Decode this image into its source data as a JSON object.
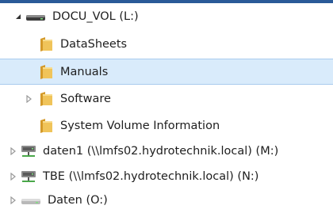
{
  "tree": {
    "drive_docu": {
      "label": "DOCU_VOL (L:)",
      "icon": "drive-icon",
      "expanded": true
    },
    "folders": [
      {
        "label": "DataSheets",
        "icon": "folder-icon",
        "has_children": false,
        "selected": false
      },
      {
        "label": "Manuals",
        "icon": "folder-icon",
        "has_children": false,
        "selected": true
      },
      {
        "label": "Software",
        "icon": "folder-icon",
        "has_children": true,
        "selected": false
      },
      {
        "label": "System Volume Information",
        "icon": "folder-icon",
        "has_children": false,
        "selected": false
      }
    ],
    "network_drives": [
      {
        "label": "daten1 (\\\\lmfs02.hydrotechnik.local) (M:)",
        "icon": "network-drive-icon"
      },
      {
        "label": "TBE (\\\\lmfs02.hydrotechnik.local) (N:)",
        "icon": "network-drive-icon"
      }
    ],
    "drive_daten": {
      "label": "Daten (O:)",
      "icon": "drive-icon"
    }
  },
  "colors": {
    "selection_bg": "#d9ebfb",
    "selection_border": "#a9cbee",
    "folder": "#e8b84a",
    "top_bar": "#2a5a98"
  }
}
